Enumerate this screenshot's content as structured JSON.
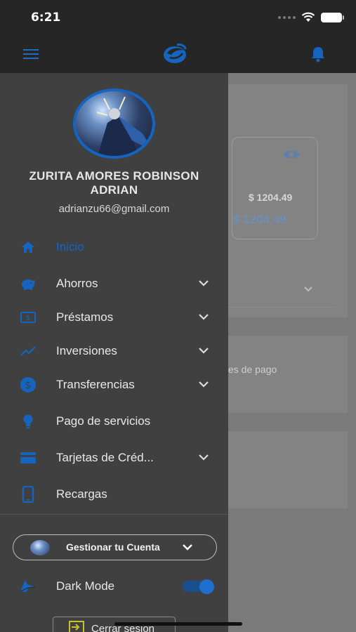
{
  "status": {
    "time": "6:21"
  },
  "colors": {
    "accent": "#1565c0",
    "drawer_bg": "#404040",
    "header_bg": "#262626"
  },
  "background": {
    "balance_primary": "$ 1204.49",
    "balance_secondary": "$ 1204.49",
    "payments_text": "es de pago"
  },
  "user": {
    "name": "ZURITA AMORES ROBINSON ADRIAN",
    "email": "adrianzu66@gmail.com"
  },
  "menu": {
    "items": [
      {
        "label": "Inicio",
        "icon": "home-icon",
        "active": true
      },
      {
        "label": "Ahorros",
        "icon": "piggy-bank-icon",
        "expandable": true
      },
      {
        "label": "Préstamos",
        "icon": "money-icon",
        "expandable": true
      },
      {
        "label": "Inversiones",
        "icon": "trending-up-icon",
        "expandable": true
      },
      {
        "label": "Transferencias",
        "icon": "dollar-circle-icon",
        "expandable": true
      },
      {
        "label": "Pago de servicios",
        "icon": "lightbulb-icon"
      },
      {
        "label": "Tarjetas de Créd...",
        "icon": "credit-card-icon",
        "expandable": true
      },
      {
        "label": "Recargas",
        "icon": "phone-icon"
      }
    ]
  },
  "account": {
    "manage_label": "Gestionar tu Cuenta"
  },
  "settings": {
    "dark_mode_label": "Dark Mode",
    "dark_mode_on": true
  },
  "logout": {
    "label": "Cerrar sesion"
  }
}
